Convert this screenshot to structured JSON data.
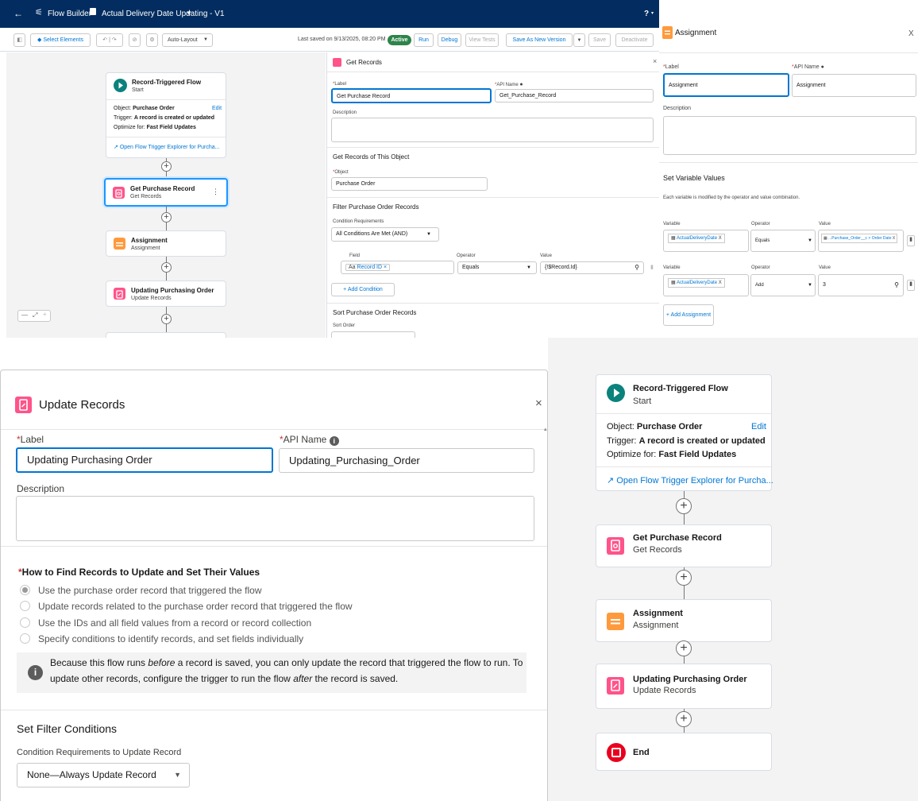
{
  "builder": {
    "app_name": "Flow Builder",
    "flow_name": "Actual Delivery Date Updating - V1",
    "help": "?",
    "toolbar": {
      "select_elements": "Select Elements",
      "layout": "Auto-Layout",
      "last_saved": "Last saved on 9/13/2025, 08:20 PM",
      "status": "Active",
      "run": "Run",
      "debug": "Debug",
      "view_tests": "View Tests",
      "save_as_new": "Save As New Version",
      "save": "Save",
      "deactivate": "Deactivate"
    },
    "zoom": {
      "minus": "—",
      "fit": "⤢",
      "plus": "+"
    }
  },
  "flow": {
    "start": {
      "title": "Record-Triggered Flow",
      "subtitle": "Start",
      "object_label": "Object:",
      "object_value": "Purchase Order",
      "edit": "Edit",
      "trigger_label": "Trigger:",
      "trigger_value": "A record is created or updated",
      "optimize_label": "Optimize for:",
      "optimize_value": "Fast Field Updates",
      "explorer_link": "Open Flow Trigger Explorer for Purcha..."
    },
    "nodes": [
      {
        "title": "Get Purchase Record",
        "subtitle": "Get Records"
      },
      {
        "title": "Assignment",
        "subtitle": "Assignment"
      },
      {
        "title": "Updating Purchasing Order",
        "subtitle": "Update Records"
      }
    ],
    "end": {
      "title": "End"
    },
    "colors": {
      "start": "#0b827c",
      "get_records": "#ff538a",
      "assignment": "#ff9a3c",
      "end": "#ea001e"
    }
  },
  "get_records_panel": {
    "title": "Get Records",
    "label_label": "Label",
    "label_value": "Get Purchase Record",
    "api_label": "API Name",
    "api_value": "Get_Purchase_Record",
    "description_label": "Description",
    "section_object": "Get Records of This Object",
    "object_label": "Object",
    "object_value": "Purchase Order",
    "section_filter": "Filter Purchase Order Records",
    "cond_req_label": "Condition Requirements",
    "cond_req_value": "All Conditions Are Met (AND)",
    "field_label": "Field",
    "field_value": "Record ID",
    "operator_label": "Operator",
    "operator_value": "Equals",
    "value_label": "Value",
    "value_value": "{!$Record.Id}",
    "add_condition": "Add Condition",
    "section_sort": "Sort Purchase Order Records",
    "sort_order_label": "Sort Order"
  },
  "assignment_panel": {
    "title": "Assignment",
    "close": "X",
    "label_label": "Label",
    "label_value": "Assignment",
    "api_label": "API Name",
    "api_value": "Assignment",
    "description_label": "Description",
    "section": "Set Variable Values",
    "helper": "Each variable is modified by the operator and value combination.",
    "rows": [
      {
        "variable_label": "Variable",
        "variable": "ActualDeliveryDate",
        "operator_label": "Operator",
        "operator": "Equals",
        "value_label": "Value",
        "value": "...Purchase_Order__c > Order Date"
      },
      {
        "variable_label": "Variable",
        "variable": "ActualDeliveryDate",
        "operator_label": "Operator",
        "operator": "Add",
        "value_label": "Value",
        "value": "3"
      }
    ],
    "add_assignment": "Add Assignment"
  },
  "update_panel": {
    "title": "Update Records",
    "close": "×",
    "label_label": "Label",
    "label_value": "Updating Purchasing Order",
    "api_label": "API Name",
    "api_value": "Updating_Purchasing_Order",
    "description_label": "Description",
    "how_to_find": "How to Find Records to Update and Set Their Values",
    "options": [
      "Use the purchase order record that triggered the flow",
      "Update records related to the purchase order record that triggered the flow",
      "Use the IDs and all field values from a record or record collection",
      "Specify conditions to identify records, and set fields individually"
    ],
    "info_1a": "Because this flow runs ",
    "info_1b": "before",
    "info_1c": " a record is saved, you can only update the record that triggered the flow to run. To",
    "info_2a": "update other records, configure the trigger to run the flow ",
    "info_2b": "after",
    "info_2c": " the record is saved.",
    "filter_section": "Set Filter Conditions",
    "cond_label": "Condition Requirements to Update Record",
    "cond_value": "None—Always Update Record"
  }
}
